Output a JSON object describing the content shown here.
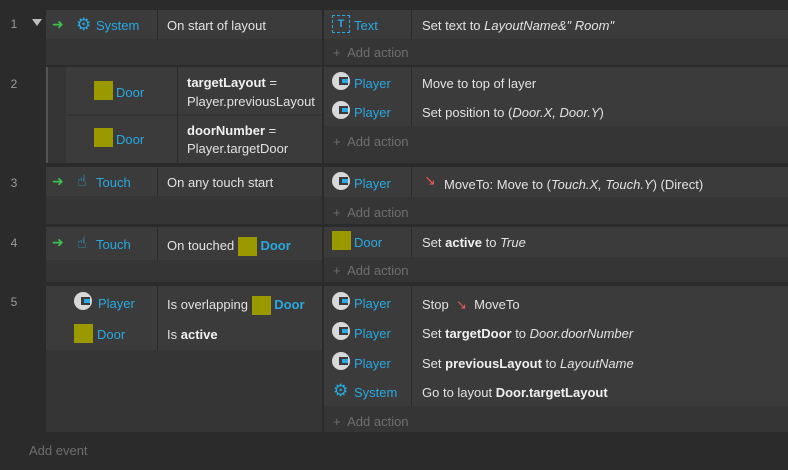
{
  "events": [
    {
      "number": "1",
      "conditions": [
        {
          "object": "System",
          "text": "On start of layout"
        }
      ],
      "actions": [
        {
          "object": "Text",
          "parts": [
            "Set text to ",
            "LayoutName&\" Room\""
          ]
        }
      ],
      "add_action": "Add action"
    },
    {
      "number": "2",
      "conditions": [
        {
          "object": "Door",
          "bold": "targetLayout",
          "rest": " =",
          "line2": "Player.previousLayout"
        },
        {
          "object": "Door",
          "bold": "doorNumber",
          "rest": " =",
          "line2": "Player.targetDoor"
        }
      ],
      "actions": [
        {
          "object": "Player",
          "text": "Move to top of layer"
        },
        {
          "object": "Player",
          "parts": [
            "Set position to (",
            "Door.X, Door.Y",
            ")"
          ]
        }
      ],
      "add_action": "Add action"
    },
    {
      "number": "3",
      "conditions": [
        {
          "object": "Touch",
          "text": "On any touch start"
        }
      ],
      "actions": [
        {
          "object": "Player",
          "parts": [
            "MoveTo: Move to (",
            "Touch.X, Touch.Y",
            ") (Direct)"
          ]
        }
      ],
      "add_action": "Add action"
    },
    {
      "number": "4",
      "conditions": [
        {
          "object": "Touch",
          "text": "On touched",
          "target": "Door"
        }
      ],
      "actions": [
        {
          "object": "Door",
          "parts": [
            "Set ",
            "active",
            " to ",
            "True"
          ]
        }
      ],
      "add_action": "Add action"
    },
    {
      "number": "5",
      "conditions": [
        {
          "object": "Player",
          "text": "Is overlapping",
          "target": "Door"
        },
        {
          "object": "Door",
          "text": "Is ",
          "bold": "active"
        }
      ],
      "actions": [
        {
          "object": "Player",
          "text": "Stop",
          "target": "MoveTo"
        },
        {
          "object": "Player",
          "parts": [
            "Set ",
            "targetDoor",
            " to ",
            "Door.doorNumber"
          ]
        },
        {
          "object": "Player",
          "parts": [
            "Set ",
            "previousLayout",
            " to ",
            "LayoutName"
          ]
        },
        {
          "object": "System",
          "parts": [
            "Go to layout ",
            "Door.targetLayout"
          ]
        }
      ],
      "add_action": "Add action"
    }
  ],
  "add_event": "Add event",
  "colors": {
    "background": "#2b2b2b",
    "cell": "#3b3b3b",
    "object_link": "#29a9e0",
    "sprite_square": "#9a9a00",
    "trigger_arrow": "#3fbf4f",
    "behavior_arrow": "#e8584f"
  },
  "icons": {
    "trigger": "green-arrow-icon",
    "system": "gear-icon",
    "text": "text-object-icon",
    "player": "construct-player-icon",
    "touch": "hand-pointer-icon",
    "door": "sprite-square-icon",
    "moveto": "red-arrow-icon",
    "add": "plus-icon",
    "expand": "triangle-down-icon"
  }
}
